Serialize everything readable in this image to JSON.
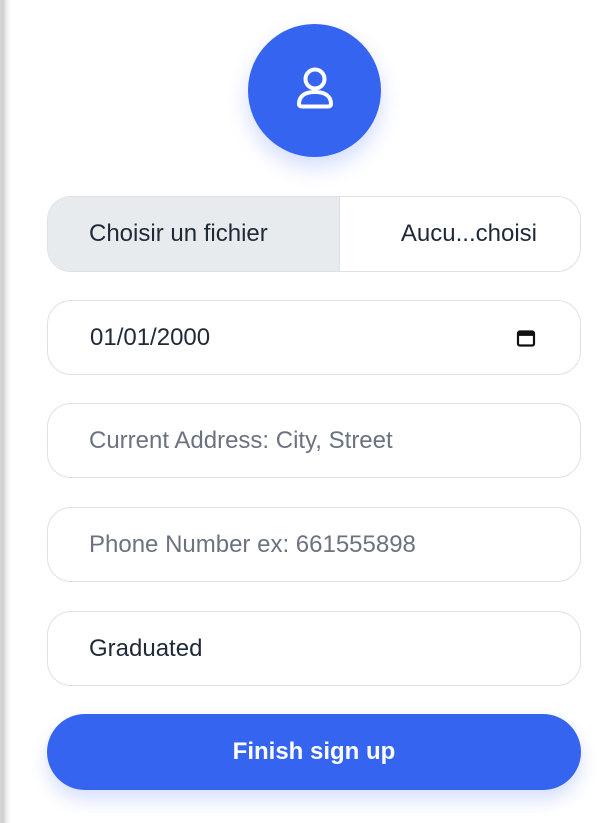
{
  "profile": {
    "avatar_icon": "user-icon",
    "avatar_color": "#3565F0"
  },
  "file_upload": {
    "button_label": "Choisir un fichier",
    "file_status": "Aucu...choisi"
  },
  "birth_date": {
    "value": "01/01/2000",
    "icon": "calendar-icon"
  },
  "address": {
    "placeholder": "Current Address: City, Street"
  },
  "phone": {
    "placeholder": "Phone Number ex: 661555898"
  },
  "education": {
    "value": "Graduated"
  },
  "submit": {
    "label": "Finish sign up",
    "color": "#3565F0"
  }
}
